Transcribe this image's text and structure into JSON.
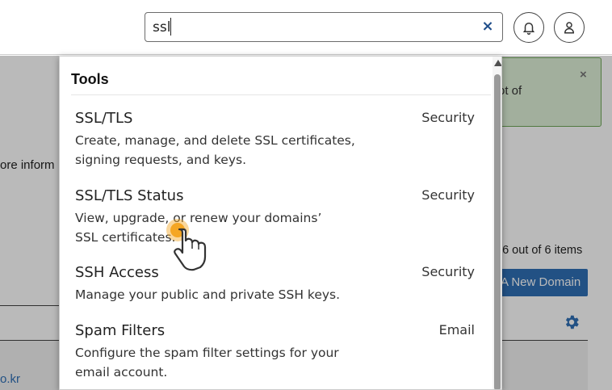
{
  "header": {
    "search_value": "ssl",
    "clear_icon": "×",
    "notifications_icon": "bell-icon",
    "user_icon": "user-icon"
  },
  "background": {
    "alert_text": "ot of",
    "alert_close": "×",
    "info_text": "ore inform",
    "items_count": "n 6 out of 6 items",
    "add_domain_button": "A New Domain",
    "domain_link": "o.kr"
  },
  "dropdown": {
    "heading": "Tools",
    "results": [
      {
        "title": "SSL/TLS",
        "category": "Security",
        "description": "Create, manage, and delete SSL certificates, signing requests, and keys."
      },
      {
        "title": "SSL/TLS Status",
        "category": "Security",
        "description": "View, upgrade, or renew your domains’ SSL certificates."
      },
      {
        "title": "SSH Access",
        "category": "Security",
        "description": "Manage your public and private SSH keys."
      },
      {
        "title": "Spam Filters",
        "category": "Email",
        "description": "Configure the spam filter settings for your email account."
      }
    ]
  },
  "colors": {
    "accent": "#2f6fb5",
    "clear_icon": "#1f4e8a",
    "alert_bg": "#dff0d8",
    "cursor_highlight": "#f5a623"
  }
}
